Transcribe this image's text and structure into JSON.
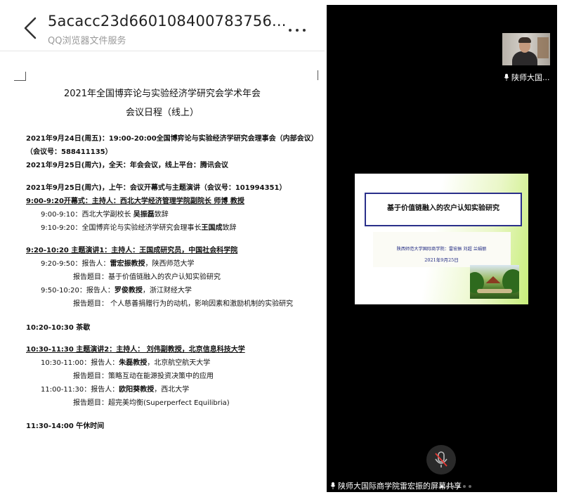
{
  "viewer": {
    "title": "5acacc23d660108400783756...",
    "subtitle": "QQ浏览器文件服务",
    "back_icon": "chevron-left-icon",
    "more_icon": "more-horizontal-icon"
  },
  "doc": {
    "heading1": "2021年全国博弈论与实验经济学研究会学术年会",
    "heading2": "会议日程（线上）",
    "l1": "2021年9月24日(周五)：19:00-20:00全国博弈论与实验经济学研究会理事会（内部会议）",
    "l2": "（会议号：588411135）",
    "l3": "2021年9月25日(周六)，全天：年会会议，线上平台：腾讯会议",
    "l4": "2021年9月25日(周六)，上午：会议开幕式与主题演讲（会议号：101994351）",
    "l5": "9:00-9:20开幕式：主持人：西北大学经济管理学院副院长  师博  教授",
    "l6a": "9:00-9:10：西北大学副校长 ",
    "l6b": "吴振磊",
    "l6c": "致辞",
    "l7a": "9:10-9:20：全国博弈论与实验经济学研究会理事长",
    "l7b": "王国成",
    "l7c": "致辞",
    "l8": "9:20-10:20  主题演讲1：主持人：王国成研究员，中国社会科学院",
    "l9a": "9:20-9:50：报告人：",
    "l9b": "雷宏振教授",
    "l9c": "，陕西师范大学",
    "l10": "报告题目：基于价值链融入的农户认知实验研究",
    "l11a": "9:50-10:20：报告人：",
    "l11b": "罗俊教授",
    "l11c": "，浙江财经大学",
    "l12": "报告题目：  个人慈善捐赠行为的动机，影响因素和激励机制的实验研究",
    "l13": "10:20-10:30  茶歇",
    "l14": "10:30-11:30  主题演讲2：主持人：  刘伟副教授，北京信息科技大学",
    "l15a": "10:30-11:00：报告人：",
    "l15b": "朱磊教授",
    "l15c": "，北京航空航天大学",
    "l16": "报告题目：策略互动在能源投资决策中的应用",
    "l17a": "11:00-11:30：报告人：",
    "l17b": "欧阳葵教授",
    "l17c": "，西北大学",
    "l18": "报告题目：超完美均衡(Superperfect Equilibria)",
    "l19": "11:30-14:00  午休时间"
  },
  "meeting": {
    "speaker_small": "陕师大国...",
    "slide_title": "基于价值链融入的农户认知实验研究",
    "slide_authors": "陕西师范大学国际商学院：雷宏振  刘超  兰娟丽",
    "slide_date": "2021年9月25日",
    "share_label": "陕师大国际商学院雷宏振的屏幕共享",
    "mic_icon": "microphone-muted-icon"
  }
}
